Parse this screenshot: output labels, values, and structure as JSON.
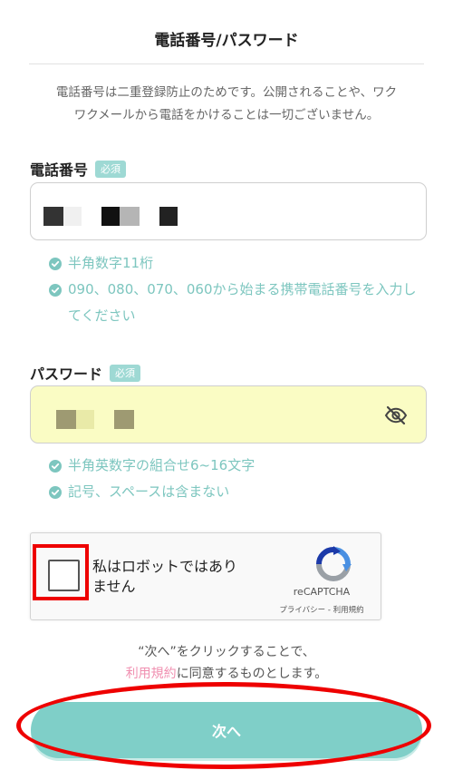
{
  "header": {
    "title": "電話番号/パスワード"
  },
  "notice": {
    "line1": "電話番号は二重登録防止のためです。公開されることや、ワク",
    "line2": "ワクメールから電話をかけることは一切ございません。"
  },
  "phone": {
    "label": "電話番号",
    "required": "必須",
    "hints": [
      "半角数字11桁",
      "090、080、070、060から始まる携帯電話番号を入力してください"
    ]
  },
  "password": {
    "label": "パスワード",
    "required": "必須",
    "hints": [
      "半角英数字の組合せ6~16文字",
      "記号、スペースは含まない"
    ]
  },
  "recaptcha": {
    "label_line1": "私はロボットではあり",
    "label_line2": "ません",
    "brand": "reCAPTCHA",
    "links": "プライバシー - 利用規約"
  },
  "agreement": {
    "line1": "“次へ”をクリックすることで、",
    "link": "利用規約",
    "line2_rest": "に同意するものとします。"
  },
  "next_button": {
    "label": "次へ"
  },
  "colors": {
    "accent": "#7fcfc8",
    "hint": "#7dc6bf",
    "password_bg": "#fafcc4",
    "link": "#f08fb0",
    "highlight": "#ee0000"
  }
}
